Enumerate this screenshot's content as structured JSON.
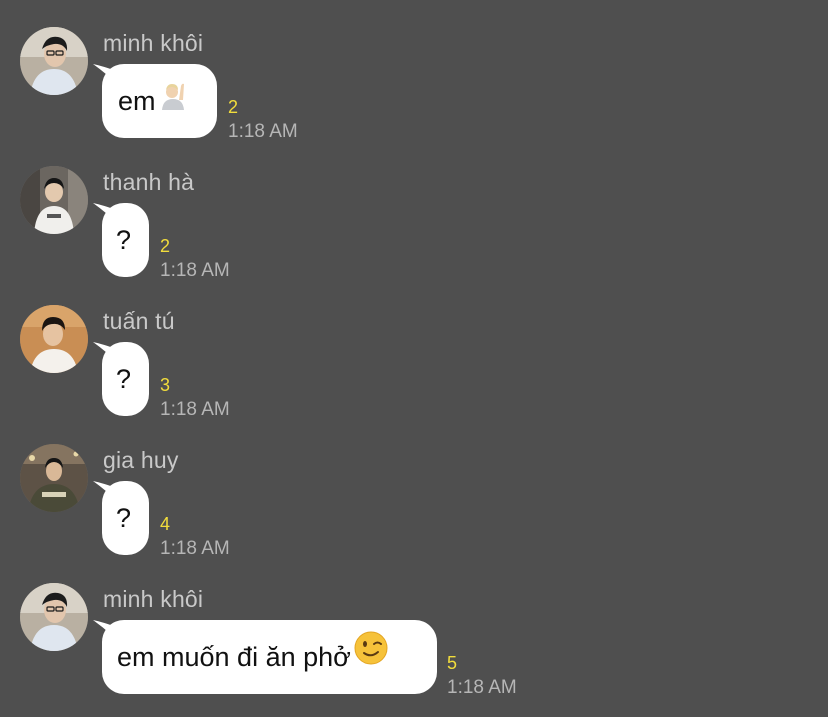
{
  "messages": [
    {
      "sender": "minh khôi",
      "text": "em",
      "emoji": "raising-hand-emoji",
      "count": "2",
      "time": "1:18 AM"
    },
    {
      "sender": "thanh hà",
      "text": "?",
      "count": "2",
      "time": "1:18 AM"
    },
    {
      "sender": "tuấn tú",
      "text": "?",
      "count": "3",
      "time": "1:18 AM"
    },
    {
      "sender": "gia huy",
      "text": "?",
      "count": "4",
      "time": "1:18 AM"
    },
    {
      "sender": "minh khôi",
      "text": "em muốn đi ăn phở",
      "emoji": "winking-face-emoji",
      "count": "5",
      "time": "1:18 AM"
    }
  ],
  "colors": {
    "background": "#4f4f4f",
    "bubble": "#ffffff",
    "sender": "#c9c9c9",
    "count": "#f2dd3c",
    "time": "#b6b6b6"
  }
}
